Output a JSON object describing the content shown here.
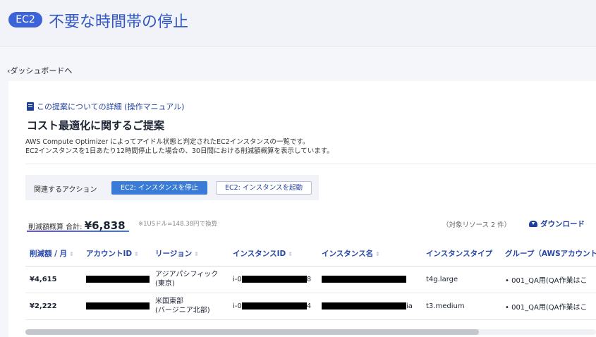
{
  "header": {
    "badge": "EC2",
    "title": "不要な時間帯の停止"
  },
  "nav": {
    "back": "ダッシュボードへ"
  },
  "card": {
    "manual_link": "この提案についての詳細 (操作マニュアル)",
    "title": "コスト最適化に関するご提案",
    "desc_line1": "AWS Compute Optimizer によってアイドル状態と判定されたEC2インスタンスの一覧です。",
    "desc_line2": "EC2インスタンスを1日あたり12時間停止した場合の、30日間における削減額概算を表示しています。"
  },
  "actions": {
    "label": "関連するアクション",
    "stop": "EC2: インスタンスを停止",
    "start": "EC2: インスタンスを起動"
  },
  "summary": {
    "total_label": "削減額概算 合計: ",
    "total_value": "¥6,838",
    "rate_note": "※1USドル=148.38円で換算",
    "resource_count": "（対象リソース 2 件）",
    "download": "ダウンロード"
  },
  "table": {
    "columns": [
      "削減額 / 月",
      "アカウントID",
      "リージョン",
      "インスタンスID",
      "インスタンス名",
      "インスタンスタイプ",
      "グループ（AWSアカウント"
    ],
    "rows": [
      {
        "amount": "¥4,615",
        "region_line1": "アジアパシフィック",
        "region_line2": "(東京)",
        "instance_id_prefix": "i-0",
        "instance_id_suffix": "8",
        "instance_name_prefix": "",
        "instance_type": "t4g.large",
        "group": "•  001_QA用(QA作業はこ"
      },
      {
        "amount": "¥2,222",
        "region_line1": "米国東部",
        "region_line2": "(バージニア北部)",
        "instance_id_prefix": "i-0",
        "instance_id_suffix": "4",
        "instance_name_suffix": "ia",
        "instance_type": "t3.medium",
        "group": "•  001_QA用(QA作業はこ"
      }
    ]
  },
  "colors": {
    "accent": "#3c63d8",
    "title": "#3157c4",
    "link": "#1f3f9a",
    "header_bg": "#f1f3f8"
  }
}
